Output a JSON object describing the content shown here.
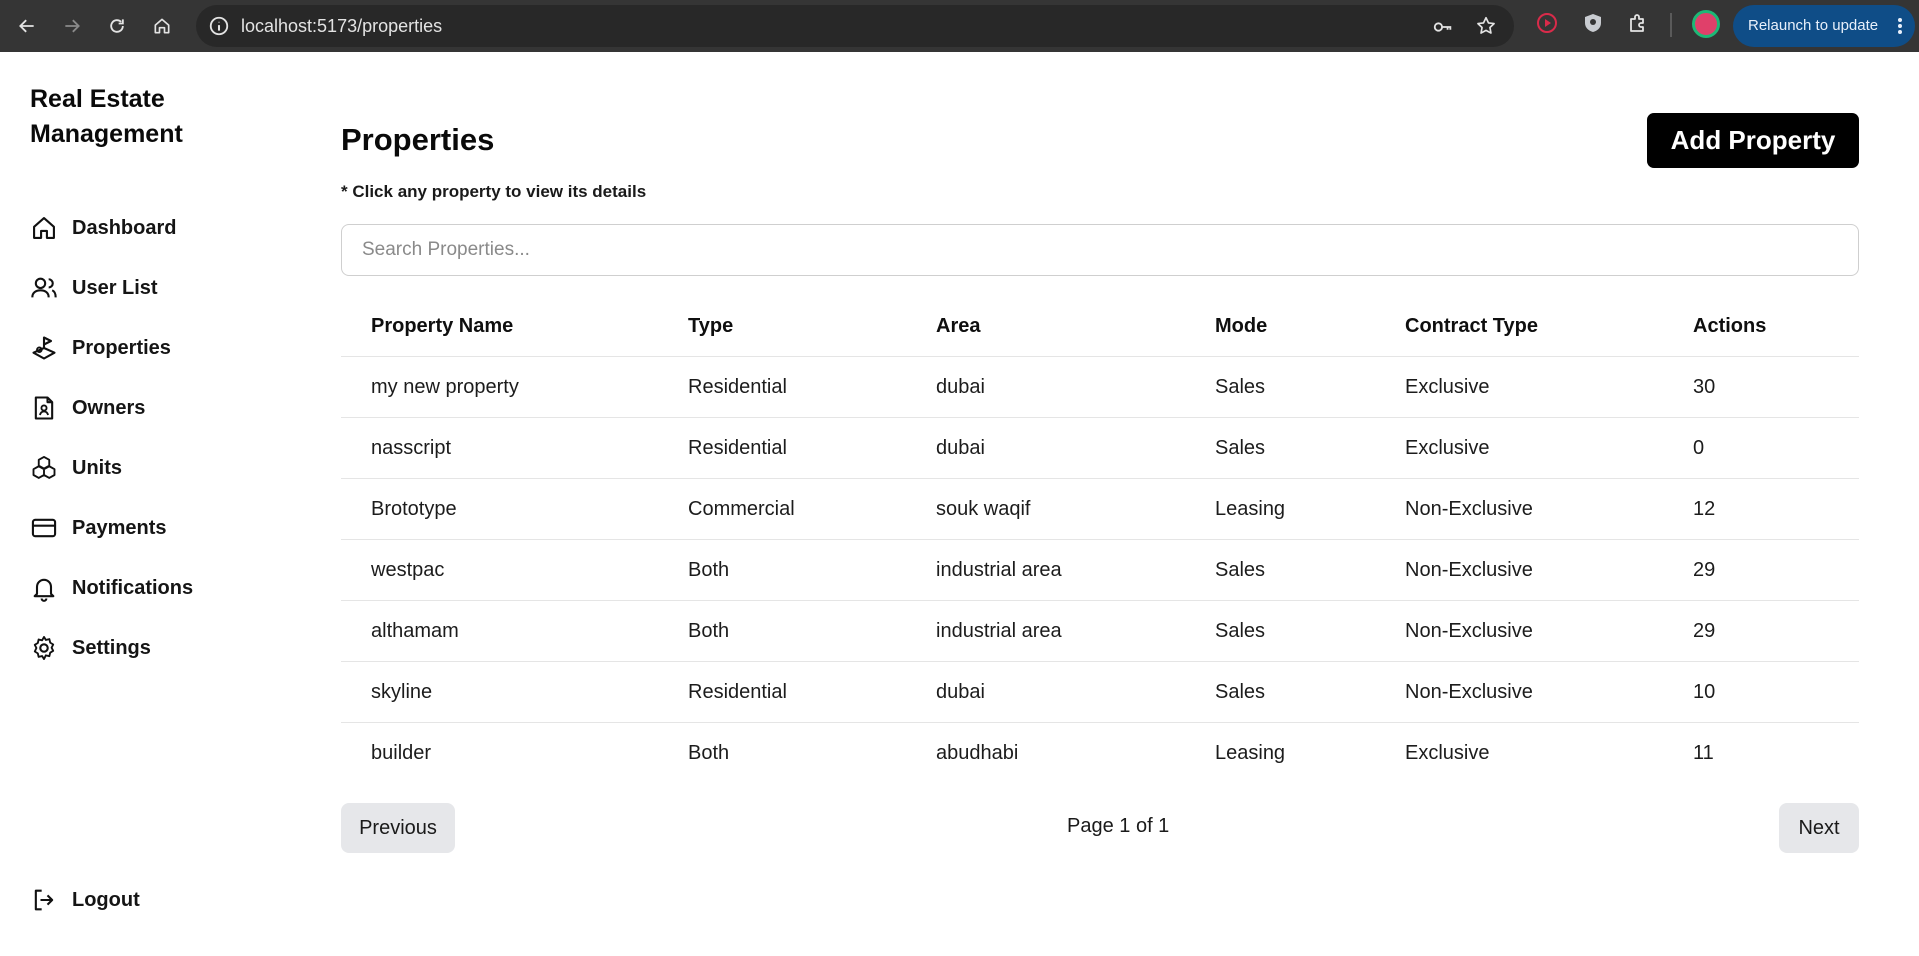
{
  "browser": {
    "url": "localhost:5173/properties",
    "relaunch_label": "Relaunch to update",
    "extension_icons": [
      "record-extension-icon",
      "shield-extension-icon",
      "puzzle-extensions-icon"
    ]
  },
  "sidebar": {
    "brand": "Real Estate Management",
    "items": [
      {
        "label": "Dashboard",
        "icon": "home-icon"
      },
      {
        "label": "User List",
        "icon": "users-icon"
      },
      {
        "label": "Properties",
        "icon": "property-icon"
      },
      {
        "label": "Owners",
        "icon": "owner-file-icon"
      },
      {
        "label": "Units",
        "icon": "boxes-icon"
      },
      {
        "label": "Payments",
        "icon": "credit-card-icon"
      },
      {
        "label": "Notifications",
        "icon": "bell-icon"
      },
      {
        "label": "Settings",
        "icon": "gear-icon"
      }
    ],
    "logout_label": "Logout"
  },
  "main": {
    "title": "Properties",
    "hint": "* Click any property to view its details",
    "add_button": "Add Property",
    "search_placeholder": "Search Properties...",
    "table": {
      "headers": [
        "Property Name",
        "Type",
        "Area",
        "Mode",
        "Contract Type",
        "Actions"
      ],
      "rows": [
        [
          "my new property",
          "Residential",
          "dubai",
          "Sales",
          "Exclusive",
          "30"
        ],
        [
          "nasscript",
          "Residential",
          "dubai",
          "Sales",
          "Exclusive",
          "0"
        ],
        [
          "Brototype",
          "Commercial",
          "souk waqif",
          "Leasing",
          "Non-Exclusive",
          "12"
        ],
        [
          "westpac",
          "Both",
          "industrial area",
          "Sales",
          "Non-Exclusive",
          "29"
        ],
        [
          "althamam",
          "Both",
          "industrial area",
          "Sales",
          "Non-Exclusive",
          "29"
        ],
        [
          "skyline",
          "Residential",
          "dubai",
          "Sales",
          "Non-Exclusive",
          "10"
        ],
        [
          "builder",
          "Both",
          "abudhabi",
          "Leasing",
          "Exclusive",
          "11"
        ]
      ]
    },
    "pagination": {
      "previous": "Previous",
      "page_info": "Page 1 of 1",
      "next": "Next"
    }
  }
}
